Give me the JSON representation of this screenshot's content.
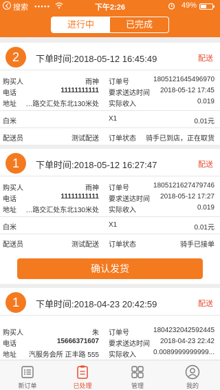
{
  "status_bar": {
    "back_label": "搜索",
    "dots": "●●●●●",
    "time": "下午2:26",
    "battery_pct": "49%"
  },
  "segment": {
    "tabs": [
      {
        "label": "进行中",
        "active": true
      },
      {
        "label": "已完成",
        "active": false
      }
    ]
  },
  "labels": {
    "buyer": "购买人",
    "phone": "电话",
    "address": "地址",
    "order_no": "订单号",
    "delivery_time": "要求送达时间",
    "actual_income": "实际收入",
    "courier": "配送员",
    "order_status": "订单状态"
  },
  "orders": [
    {
      "badge": "2",
      "order_time": "下单时间:2018-05-12 16:45:49",
      "tag": "配送",
      "buyer": "雨神",
      "order_no": "1805121645496970",
      "phone": "11111111111",
      "delivery_time": "2018-05-12 17:45",
      "address": "…路交汇处东北130米处",
      "actual_income": "0.019",
      "item_name": "白米",
      "item_qty": "X1",
      "item_price": "0.01元",
      "courier": "测试配送",
      "order_status": "骑手已到店，正在取货"
    },
    {
      "badge": "1",
      "order_time": "下单时间:2018-05-12 16:27:47",
      "tag": "配送",
      "buyer": "雨神",
      "order_no": "1805121627479746",
      "phone": "11111111111",
      "delivery_time": "2018-05-12 17:27",
      "address": "…路交汇处东北130米处",
      "actual_income": "0.019",
      "item_name": "白米",
      "item_qty": "X1",
      "item_price": "0.01元",
      "courier": "测试配送",
      "order_status": "骑手已接单"
    },
    {
      "badge": "1",
      "order_time": "下单时间:2018-04-23 20:42:59",
      "tag": "配送",
      "buyer": "朱",
      "order_no": "1804232042592445",
      "phone": "15666371607",
      "delivery_time": "2018-04-23 22:42",
      "address": "汽服务会所 正丰路 555",
      "actual_income": "0.0089999999999..."
    }
  ],
  "confirm_button": "确认发货",
  "tabbar": {
    "tabs": [
      {
        "label": "新订单",
        "icon": "list-icon",
        "active": false
      },
      {
        "label": "已处理",
        "icon": "clipboard-icon",
        "active": true
      },
      {
        "label": "管理",
        "icon": "grid-icon",
        "active": false
      },
      {
        "label": "我的",
        "icon": "user-icon",
        "active": false
      }
    ]
  },
  "colors": {
    "accent": "#f47a20",
    "tag_red": "#e94a2f",
    "background": "#eeeeee"
  }
}
